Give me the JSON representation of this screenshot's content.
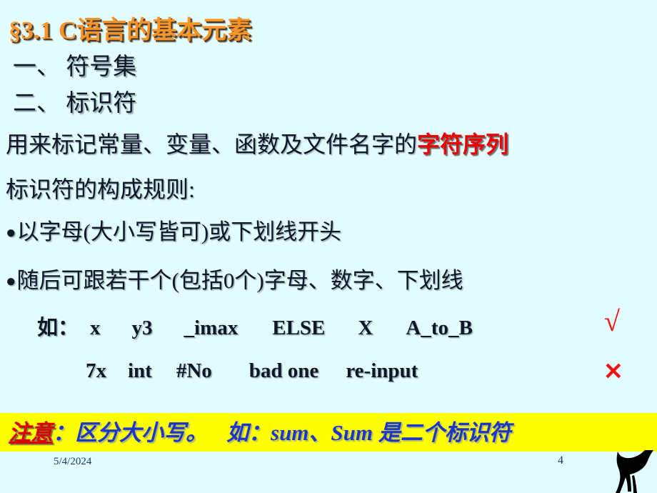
{
  "slide": {
    "background_color": "#e2fbfc",
    "title": "§3.1  C语言的基本元素",
    "title_color": "#f79428",
    "subheadings": [
      "一、 符号集",
      "二、 标识符"
    ],
    "definition": {
      "prefix": "用来标记常量、变量、函数及文件名字的",
      "emphasis": "字符序列",
      "emphasis_color": "#ee0000"
    },
    "rules_heading": "标识符的构成规则:",
    "bullets": [
      {
        "marker": "●",
        "text": "以字母(大小写皆可)或下划线开头"
      },
      {
        "marker": "●",
        "text": "随后可跟若干个(包括0个)字母、数字、下划线"
      }
    ],
    "examples": {
      "valid": {
        "label": "如：",
        "items": [
          "x",
          "y3",
          "_imax",
          "ELSE",
          "X",
          "A_to_B"
        ],
        "mark": "√",
        "mark_color": "#ee1111"
      },
      "invalid": {
        "items": [
          "7x",
          "int",
          "#No",
          "bad one",
          "re-input"
        ],
        "mark": "✕",
        "mark_color": "#ee1111"
      }
    },
    "note": {
      "background_color": "#ffff00",
      "label": "注意",
      "label_color": "#dd0000",
      "body": "：区分大小写。",
      "body2": "如：sum、Sum 是二个标识符",
      "body_color": "#1b37c8"
    },
    "footer": {
      "date": "5/4/2024",
      "page_number": "4",
      "text_color": "#163a6b",
      "decoration_icon": "animal-silhouette-icon"
    }
  }
}
